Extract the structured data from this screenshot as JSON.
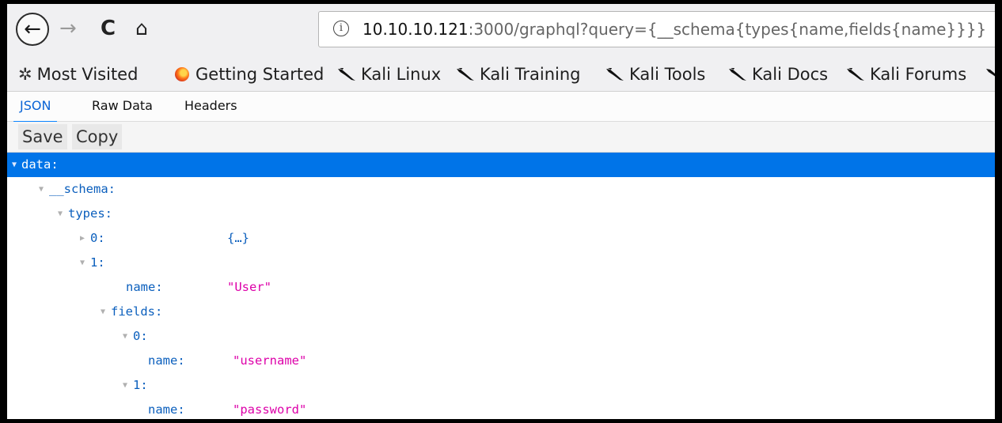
{
  "nav": {
    "back_glyph": "←",
    "forward_glyph": "→",
    "reload_glyph": "C",
    "home_glyph": "⌂",
    "info_glyph": "i",
    "url_host": "10.10.10.121",
    "url_rest": ":3000/graphql?query={__schema{types{name,fields{name}}}}"
  },
  "bookmarks": [
    {
      "icon": "gear-icon",
      "label": "Most Visited"
    },
    {
      "icon": "firefox-icon",
      "label": "Getting Started"
    },
    {
      "icon": "kali-dragon-icon",
      "label": "Kali Linux"
    },
    {
      "icon": "kali-dragon-icon",
      "label": "Kali Training"
    },
    {
      "icon": "kali-dragon-icon",
      "label": "Kali Tools"
    },
    {
      "icon": "kali-dragon-icon",
      "label": "Kali Docs"
    },
    {
      "icon": "kali-dragon-icon",
      "label": "Kali Forums"
    }
  ],
  "tabs": [
    {
      "label": "JSON",
      "active": true
    },
    {
      "label": "Raw Data",
      "active": false
    },
    {
      "label": "Headers",
      "active": false
    }
  ],
  "toolbar": {
    "save_label": "Save",
    "copy_label": "Copy"
  },
  "tree": [
    {
      "key": "data:",
      "value": "",
      "expanded": true,
      "selected": true
    },
    {
      "key": "__schema:",
      "value": "",
      "expanded": true
    },
    {
      "key": "types:",
      "value": "",
      "expanded": true
    },
    {
      "key": "0:",
      "value": "{…}",
      "expanded": false
    },
    {
      "key": "1:",
      "value": "",
      "expanded": true
    },
    {
      "key": "name:",
      "value": "\"User\""
    },
    {
      "key": "fields:",
      "value": "",
      "expanded": true
    },
    {
      "key": "0:",
      "value": "",
      "expanded": true
    },
    {
      "key": "name:",
      "value": "\"username\""
    },
    {
      "key": "1:",
      "value": "",
      "expanded": true
    },
    {
      "key": "name:",
      "value": "\"password\""
    }
  ],
  "colors": {
    "selection": "#0074e8",
    "key": "#0b5fbd",
    "string": "#dd00a9",
    "active_tab": "#0a64d6"
  }
}
